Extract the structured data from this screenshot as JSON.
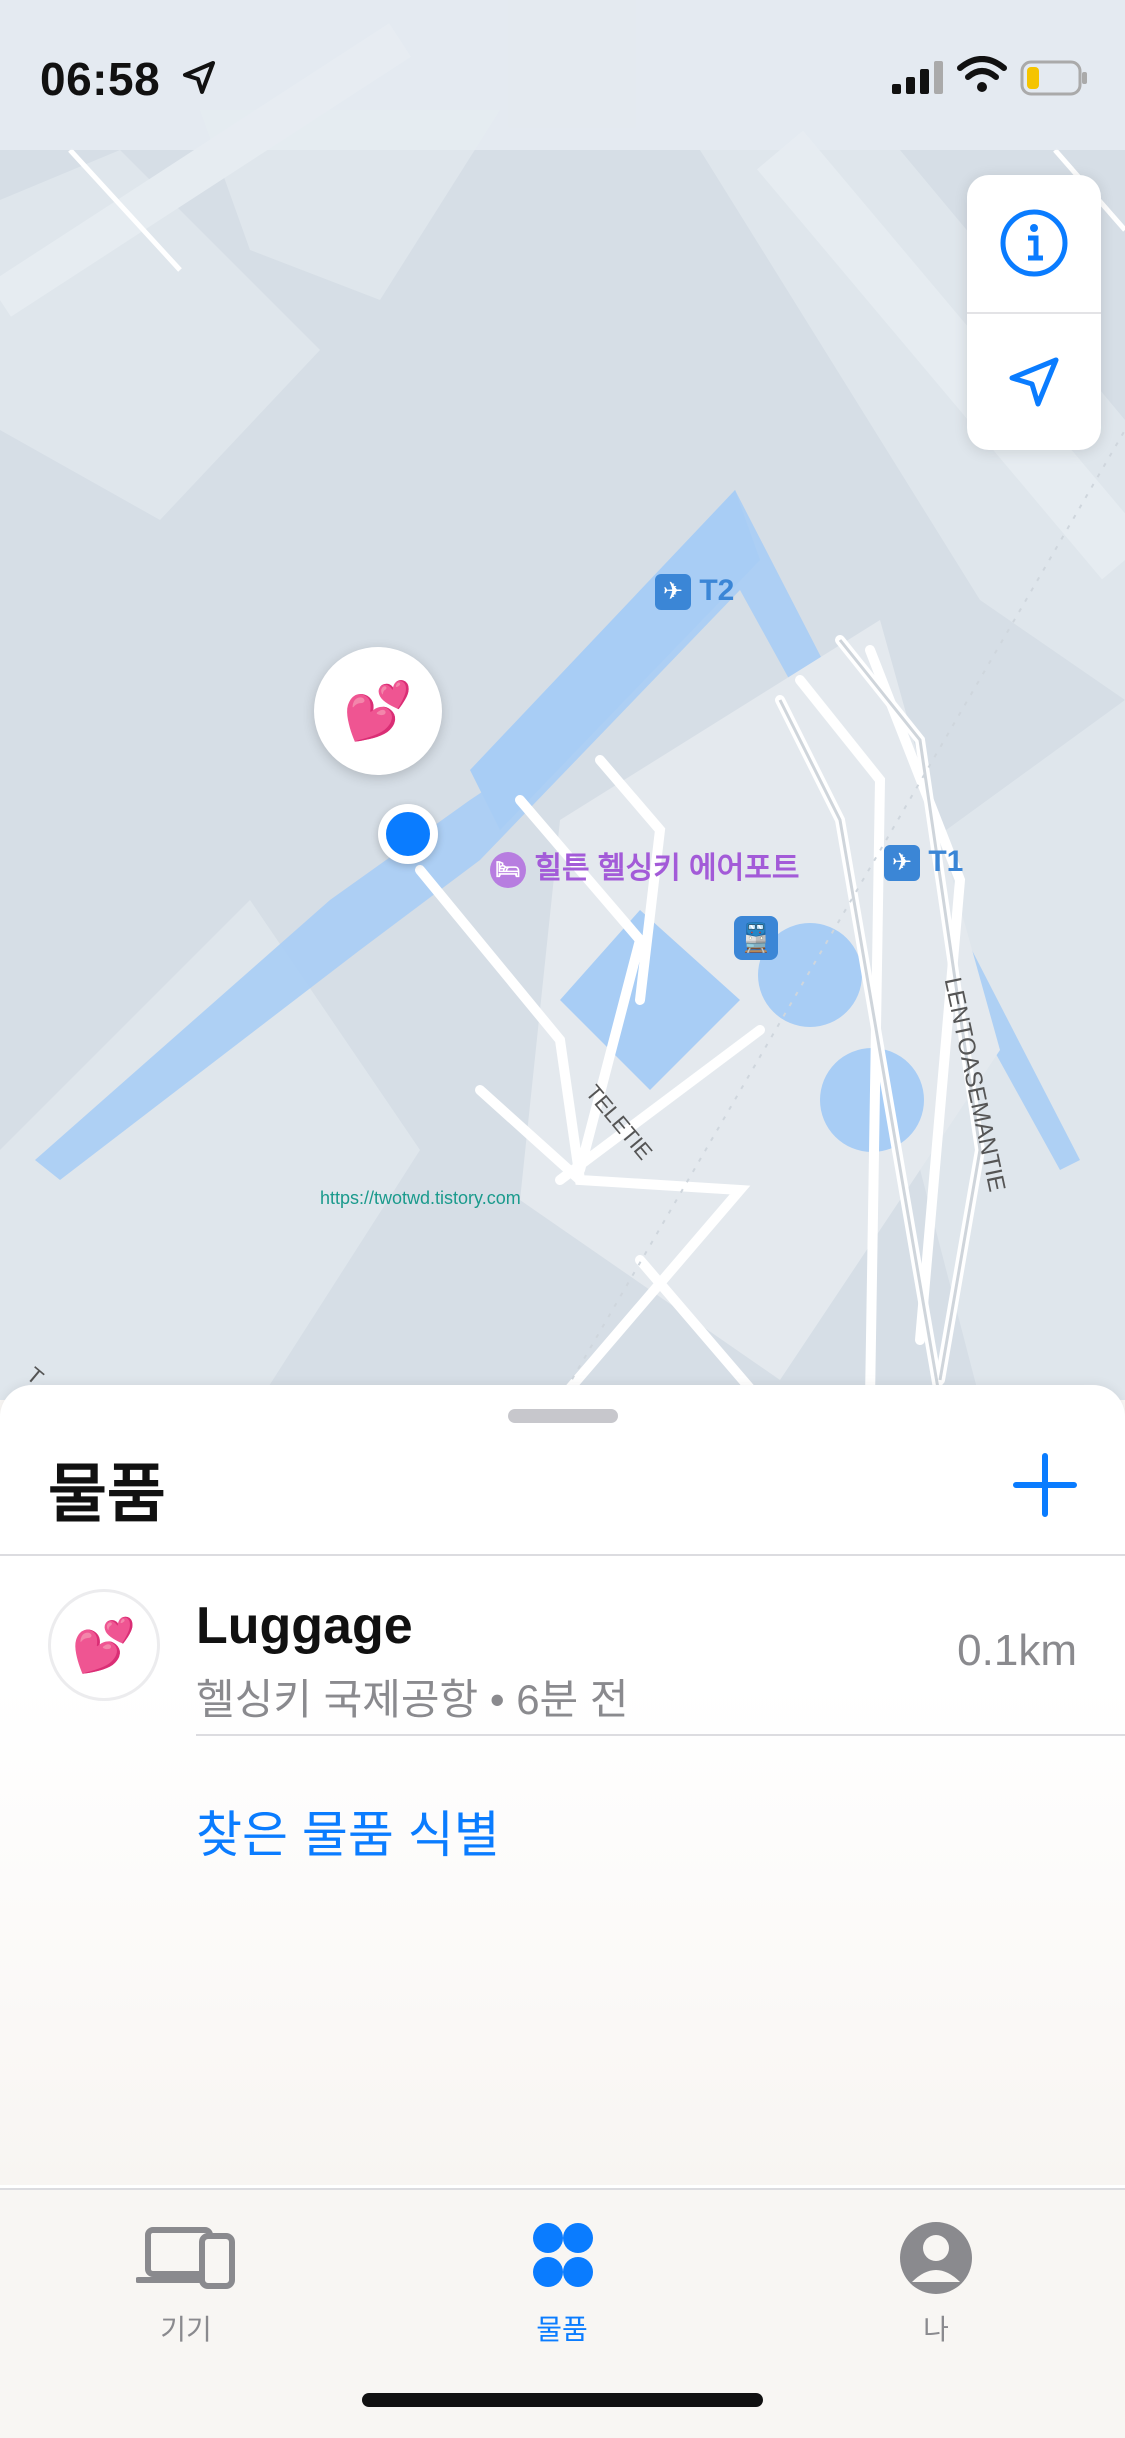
{
  "status_bar": {
    "time": "06:58"
  },
  "map": {
    "labels": {
      "t2": "T2",
      "t1": "T1",
      "hotel": "힐튼 헬싱키 에어포트",
      "road1": "TELETIE",
      "road2": "LENTOASEMANTIE",
      "road3": "T"
    },
    "watermark": "https://twotwd.tistory.com",
    "pin_emoji": "💕"
  },
  "sheet": {
    "title": "물품",
    "items": [
      {
        "emoji": "💕",
        "name": "Luggage",
        "location": "헬싱키 국제공항 • 6분 전",
        "distance": "0.1km"
      }
    ],
    "identify_link": "찾은 물품 식별"
  },
  "tabbar": {
    "tabs": [
      {
        "label": "기기",
        "active": false
      },
      {
        "label": "물품",
        "active": true
      },
      {
        "label": "나",
        "active": false
      }
    ]
  },
  "colors": {
    "accent": "#0a7cff",
    "hotel": "#a35bd8",
    "terminal": "#3b86d6"
  }
}
